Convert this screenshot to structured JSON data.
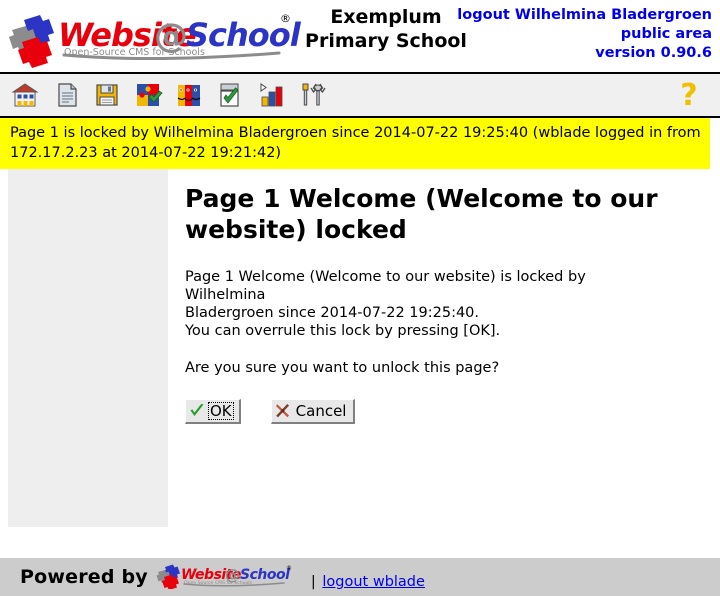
{
  "header": {
    "logo": {
      "name": "website-at-school-logo",
      "word1": "Website",
      "at": "@",
      "word2": "School",
      "registered": "®",
      "tagline": "Open-Source CMS for Schools"
    },
    "school_name_line1": "Exemplum",
    "school_name_line2": "Primary School",
    "account": {
      "logout_label": "logout Wilhelmina Bladergroen",
      "area_label": "public area",
      "version_label": "version 0.90.6"
    }
  },
  "toolbar": {
    "items": [
      {
        "icon": "school-house-icon",
        "label": "School"
      },
      {
        "icon": "page-document-icon",
        "label": "Pages"
      },
      {
        "icon": "floppy-disk-icon",
        "label": "File manager"
      },
      {
        "icon": "puzzle-modules-icon",
        "label": "Modules"
      },
      {
        "icon": "visitors-faces-icon",
        "label": "Visitors"
      },
      {
        "icon": "checklist-icon",
        "label": "Tasks"
      },
      {
        "icon": "bar-chart-statistics-icon",
        "label": "Statistics"
      },
      {
        "icon": "tools-wrench-icon",
        "label": "Tools"
      }
    ],
    "help": {
      "icon": "question-mark-help-icon",
      "label": "?"
    }
  },
  "message": {
    "text": "Page 1 is locked by Wilhelmina Bladergroen since 2014-07-22 19:25:40 (wblade logged in from 172.17.2.23 at 2014-07-22 19:21:42)",
    "background_color": "#ffff00"
  },
  "content": {
    "page_title": "Page 1 Welcome (Welcome to our website) locked",
    "paragraph1_line1": "Page 1 Welcome (Welcome to our website) is locked by Wilhelmina",
    "paragraph1_line2": "Bladergroen since 2014-07-22 19:25:40.",
    "paragraph1_line3": "You can overrule this lock by pressing [OK].",
    "paragraph2": "Are you sure you want to unlock this page?",
    "buttons": {
      "ok": {
        "label": "OK",
        "icon": "green-checkmark-icon",
        "focused": true
      },
      "cancel": {
        "label": "Cancel",
        "icon": "red-cross-icon",
        "focused": false
      }
    }
  },
  "footer": {
    "powered_by": "Powered by",
    "logo": {
      "name": "website-at-school-logo-small",
      "word1": "Website",
      "at": "@",
      "word2": "School",
      "registered": "®",
      "tagline": "Open Source CMS for Schools"
    },
    "separator": "|",
    "logout_link": "logout wblade"
  },
  "colors": {
    "accent_blue": "#0000ee",
    "logo_red": "#e8000d",
    "warning_yellow": "#ffff00",
    "footer_gray": "#cccccc",
    "sidebar_gray": "#eeeeee",
    "help_gold": "#f0c000"
  }
}
